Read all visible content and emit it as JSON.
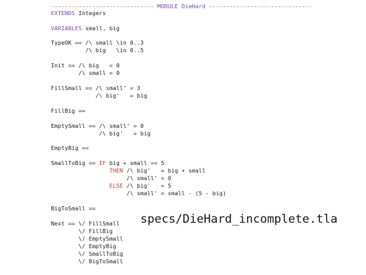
{
  "editor": {
    "colors": {
      "keyword": "#7a4aa8",
      "highlight": "#c0392b",
      "text": "#222222"
    },
    "lines": [
      {
        "segments": [
          {
            "t": "------------------------------ ",
            "c": "hl"
          },
          {
            "t": "MODULE DieHard",
            "c": "kw"
          },
          {
            "t": " ------------------------------",
            "c": "hl"
          }
        ]
      },
      {
        "segments": [
          {
            "t": "EXTENDS",
            "c": "kw"
          },
          {
            "t": " Integers",
            "c": ""
          }
        ]
      },
      {
        "segments": [
          {
            "t": "VARIABLES",
            "c": "kw"
          },
          {
            "t": " small, big",
            "c": ""
          }
        ]
      },
      {
        "segments": [
          {
            "t": "TypeOK == /\\ small \\in 0..3",
            "c": ""
          }
        ]
      },
      {
        "segments": [
          {
            "t": "          /\\ big   \\in 0..5",
            "c": ""
          }
        ]
      },
      {
        "segments": [
          {
            "t": "Init == /\\ big   = 0",
            "c": ""
          }
        ]
      },
      {
        "segments": [
          {
            "t": "        /\\ small = 0",
            "c": ""
          }
        ]
      },
      {
        "segments": [
          {
            "t": "FillSmall == /\\ small' = 3",
            "c": ""
          }
        ]
      },
      {
        "segments": [
          {
            "t": "             /\\ big'   = big",
            "c": ""
          }
        ]
      },
      {
        "segments": [
          {
            "t": "FillBig ==",
            "c": ""
          }
        ]
      },
      {
        "segments": [
          {
            "t": "EmptySmall == /\\ small' = 0",
            "c": ""
          }
        ]
      },
      {
        "segments": [
          {
            "t": "              /\\ big'   = big",
            "c": ""
          }
        ]
      },
      {
        "segments": [
          {
            "t": "EmptyBig ==",
            "c": ""
          }
        ]
      },
      {
        "segments": [
          {
            "t": "SmallToBig == ",
            "c": ""
          },
          {
            "t": "IF",
            "c": "hl"
          },
          {
            "t": " big + small =< 5",
            "c": ""
          }
        ]
      },
      {
        "segments": [
          {
            "t": "                 ",
            "c": ""
          },
          {
            "t": "THEN",
            "c": "hl"
          },
          {
            "t": " /\\ big'   = big + small",
            "c": ""
          }
        ]
      },
      {
        "segments": [
          {
            "t": "                      /\\ small' = 0",
            "c": ""
          }
        ]
      },
      {
        "segments": [
          {
            "t": "                 ",
            "c": ""
          },
          {
            "t": "ELSE",
            "c": "hl"
          },
          {
            "t": " /\\ big'   = 5",
            "c": ""
          }
        ]
      },
      {
        "segments": [
          {
            "t": "                      /\\ small' = small - (5 - big)",
            "c": ""
          }
        ]
      },
      {
        "segments": [
          {
            "t": "BigToSmall ==",
            "c": ""
          }
        ]
      },
      {
        "segments": [
          {
            "t": "Next == \\/ FillSmall",
            "c": ""
          }
        ]
      },
      {
        "segments": [
          {
            "t": "        \\/ FillBig",
            "c": ""
          }
        ]
      },
      {
        "segments": [
          {
            "t": "        \\/ EmptySmall",
            "c": ""
          }
        ]
      },
      {
        "segments": [
          {
            "t": "        \\/ EmptyBig",
            "c": ""
          }
        ]
      },
      {
        "segments": [
          {
            "t": "        \\/ SmallToBig",
            "c": ""
          }
        ]
      },
      {
        "segments": [
          {
            "t": "        \\/ BigToSmall",
            "c": ""
          }
        ]
      }
    ]
  },
  "caption": "specs/DieHard_incomplete.tla"
}
